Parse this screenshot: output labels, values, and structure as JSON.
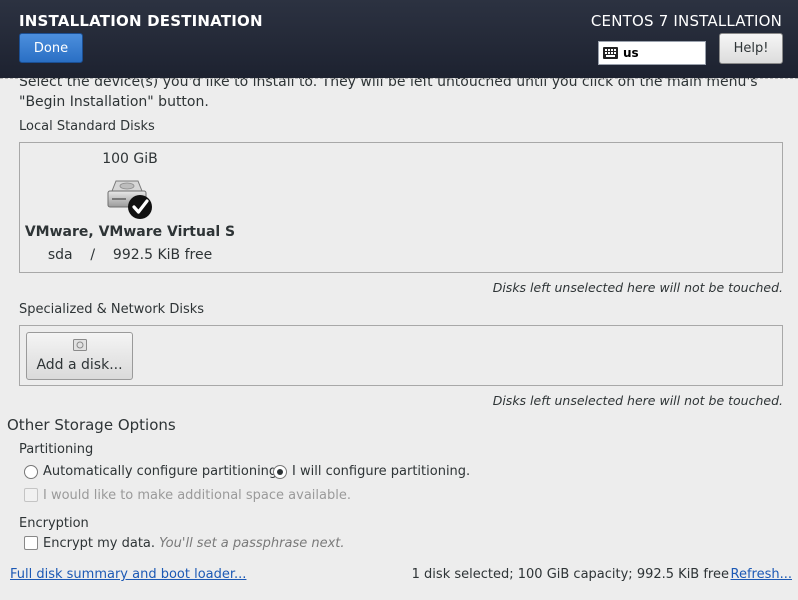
{
  "header": {
    "title": "INSTALLATION DESTINATION",
    "product": "CENTOS 7 INSTALLATION",
    "done_label": "Done",
    "keyboard_layout": "us",
    "help_label": "Help!"
  },
  "intro": {
    "line1": "Select the device(s) you'd like to install to. They will be left untouched until you click on the main menu's",
    "line2": "\"Begin Installation\" button."
  },
  "local_disks": {
    "section_label": "Local Standard Disks",
    "disks": [
      {
        "size": "100 GiB",
        "name": "VMware, VMware Virtual S",
        "device": "sda",
        "separator": "/",
        "free": "992.5 KiB free",
        "selected": true,
        "icon": "hard-disk-checked-icon"
      }
    ],
    "note": "Disks left unselected here will not be touched."
  },
  "network_disks": {
    "section_label": "Specialized & Network Disks",
    "add_disk_label": "Add a disk...",
    "note": "Disks left unselected here will not be touched."
  },
  "other_storage": {
    "title": "Other Storage Options",
    "partitioning_label": "Partitioning",
    "auto_option": "Automatically configure partitioning.",
    "manual_option": "I will configure partitioning.",
    "selected_option": "manual",
    "additional_space": "I would like to make additional space available.",
    "encryption_label": "Encryption",
    "encrypt_option": "Encrypt my data.",
    "encrypt_hint": "You'll set a passphrase next."
  },
  "footer": {
    "summary_link": "Full disk summary and boot loader...",
    "status": "1 disk selected; 100 GiB capacity; 992.5 KiB free",
    "refresh_link": "Refresh..."
  }
}
